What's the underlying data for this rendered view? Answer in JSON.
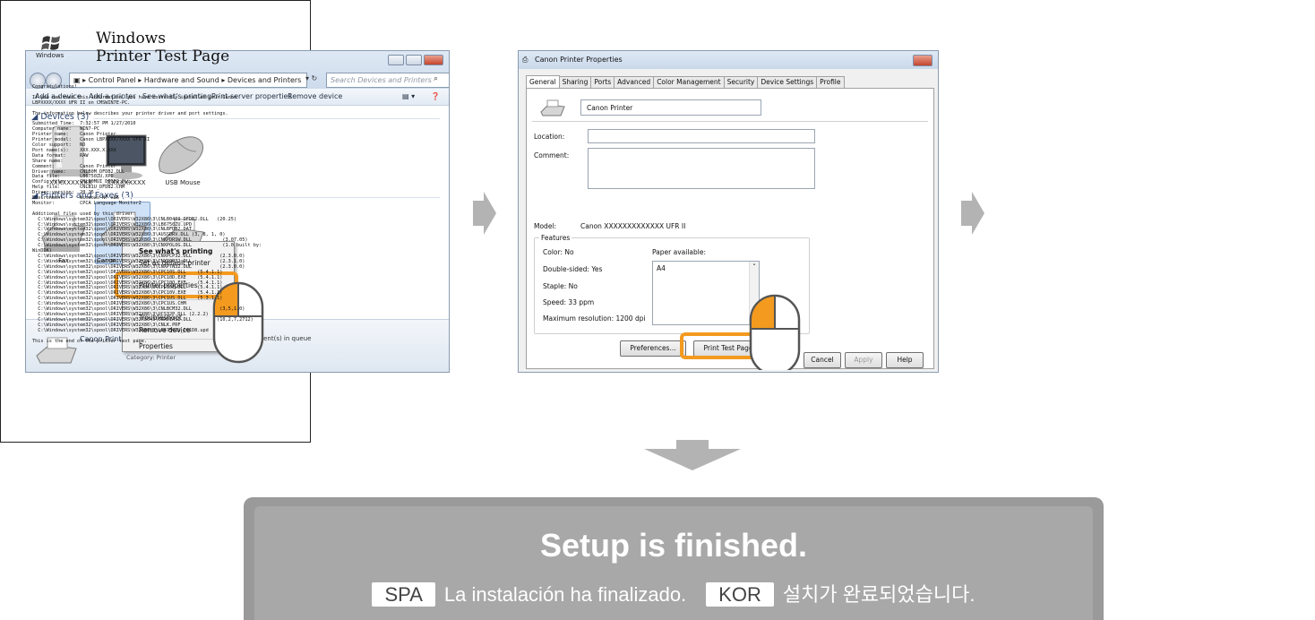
{
  "panel1": {
    "breadcrumb": [
      "Control Panel",
      "Hardware and Sound",
      "Devices and Printers"
    ],
    "search_placeholder": "Search Devices and Printers",
    "toolbar": [
      "Add a device",
      "Add a printer",
      "See what's printing",
      "Print server properties",
      "Remove device"
    ],
    "devices_group": "Devices (3)",
    "devices": [
      "XXXXXXXXXX",
      "XXXXXXXXX",
      "USB Mouse"
    ],
    "printers_group": "Printers and Faxes (3)",
    "printers": [
      "Fax",
      "Canon"
    ],
    "context_menu": [
      "See what's printing",
      "Set as default printer",
      "Printer properties",
      "Troubleshoot",
      "Remove device",
      "Properties"
    ],
    "details_name": "Canon Printer",
    "details_queue": "cument(s) in queue",
    "details_category": "Category: Printer"
  },
  "panel2": {
    "title": "Canon Printer Properties",
    "tabs": [
      "General",
      "Sharing",
      "Ports",
      "Advanced",
      "Color Management",
      "Security",
      "Device Settings",
      "Profile"
    ],
    "printer_name": "Canon Printer",
    "location_label": "Location:",
    "comment_label": "Comment:",
    "model_label": "Model:",
    "model_value": "Canon XXXXXXXXXXXXX UFR II",
    "features_label": "Features",
    "color": "Color: No",
    "double_sided": "Double-sided: Yes",
    "staple": "Staple: No",
    "speed": "Speed: 33 ppm",
    "max_res": "Maximum resolution: 1200 dpi",
    "paper_available_label": "Paper available:",
    "paper_value": "A4",
    "preferences_button": "Preferences...",
    "print_test_button": "Print Test Page",
    "cancel_button": "Cancel",
    "apply_button": "Apply",
    "help_button": "Help"
  },
  "panel3": {
    "logo_text": "Windows",
    "title_line1": "Windows",
    "title_line2": "Printer Test Page",
    "body": "Congratulations!\n\nIf you can read this information, you have correctly installed your Canon\nLBPXXXX/XXXX UFR II on CMSWIN7E-PC.\n\nThe information below describes your printer driver and port settings.\n\nSubmitted Time:  7:32:57 PM 1/27/2010\nComputer name:   WIN7-PC\nPrinter name:    Canon Printer\nPrinter model:   Canon LBPXXXX/XXXX UFR II\nColor support:   NO\nPort name(s):    XXX.XXX.X.XXX\nData format:     RAW\nShare name:\nComment:         Canon Printer\nDriver name:     CNLB0M_DFDB2.DLL\nData file:       LB6750ZU.XPD\nConfig file:     CNLB0MUI_DFDB2.DLL\nHelp file:       CNLB1U_DFDB2.CHM\nDriver version:  20.25\nEnvironment:     Windows NT x86\nMonitor:         CPCA Language Monitor2\n\nAdditional files used by this driver:\n  C:\\Windows\\system32\\spool\\DRIVERS\\W32X86\\3\\CNLB0409_DFDB2.DLL   (20.25)\n  C:\\Windows\\system32\\spool\\DRIVERS\\W32X86\\3\\LB6750ZU.UPD\n  C:\\Windows\\system32\\spool\\DRIVERS\\W32X86\\3\\CNLBFDB2.DAT\n  C:\\Windows\\system32\\spool\\DRIVERS\\W32X86\\3\\AUSSDRV.DLL (3, 8, 1, 0)\n  C:\\Windows\\system32\\spool\\DRIVERS\\W32X86\\3\\CNXPDRSW.DLL           (3.07.05)\n  C:\\Windows\\system32\\spool\\DRIVERS\\W32X86\\3\\CNXPOLOG.DLL           (1.0 built by:\nWinDDK)\n  C:\\Windows\\system32\\spool\\DRIVERS\\W32X86\\3\\CNXPCP32.DLL          (2.3.0.0)\n  C:\\Windows\\system32\\spool\\DRIVERS\\W32X86\\3\\CNXPCP32.DLL          (2.3.1.0)\n  C:\\Windows\\system32\\spool\\DRIVERS\\W32X86\\3\\CNXPTN32.DLL          (2.3.0.0)\n  C:\\Windows\\system32\\spool\\DRIVERS\\W32X86\\3\\CPC10S.DLL    (5.4.1.1)\n  C:\\Windows\\system32\\spool\\DRIVERS\\W32X86\\3\\CPC10D.EXE    (5.4.1.1)\n  C:\\Windows\\system32\\spool\\DRIVERS\\W32X86\\3\\CPC10Q.EXE    (5.4.1.1)\n  C:\\Windows\\system32\\spool\\DRIVERS\\W32X86\\3\\CPC10E.DLL    (5.4.1.1)\n  C:\\Windows\\system32\\spool\\DRIVERS\\W32X86\\3\\CPC10V.EXE    (5.4.1.1)\n  C:\\Windows\\system32\\spool\\DRIVERS\\W32X86\\3\\CPC1US.DLL    (5.3.1.1)\n  C:\\Windows\\system32\\spool\\DRIVERS\\W32X86\\3\\CPC1US.CHM\n  C:\\Windows\\system32\\spool\\DRIVERS\\W32X86\\3\\CNLBCM32.DLL          (3,5,1,0)\n  C:\\Windows\\system32\\spool\\DRIVERS\\W32X86\\3\\UCS32P.DLL (2.2.2)\n  C:\\Windows\\system32\\spool\\DRIVERS\\W32X86\\3\\CNXDIAS2.DLL         (10,2,7,2712)\n  C:\\Windows\\system32\\spool\\DRIVERS\\W32X86\\3\\CNLK.PRF\n  C:\\Windows\\system32\\spool\\DRIVERS\\W32X86\\3\\LB6750ZU_D01D8.upd\n\nThis is the end of the printer test page."
  },
  "banner": {
    "title": "Setup is finished.",
    "spa_tag": "SPA",
    "spa_text": "La instalación ha finalizado.",
    "kor_tag": "KOR",
    "kor_text": "설치가 완료되었습니다."
  },
  "colors": {
    "highlight": "#f39a1f",
    "banner": "#a8a8a8",
    "arrow": "#b3b3b3"
  }
}
